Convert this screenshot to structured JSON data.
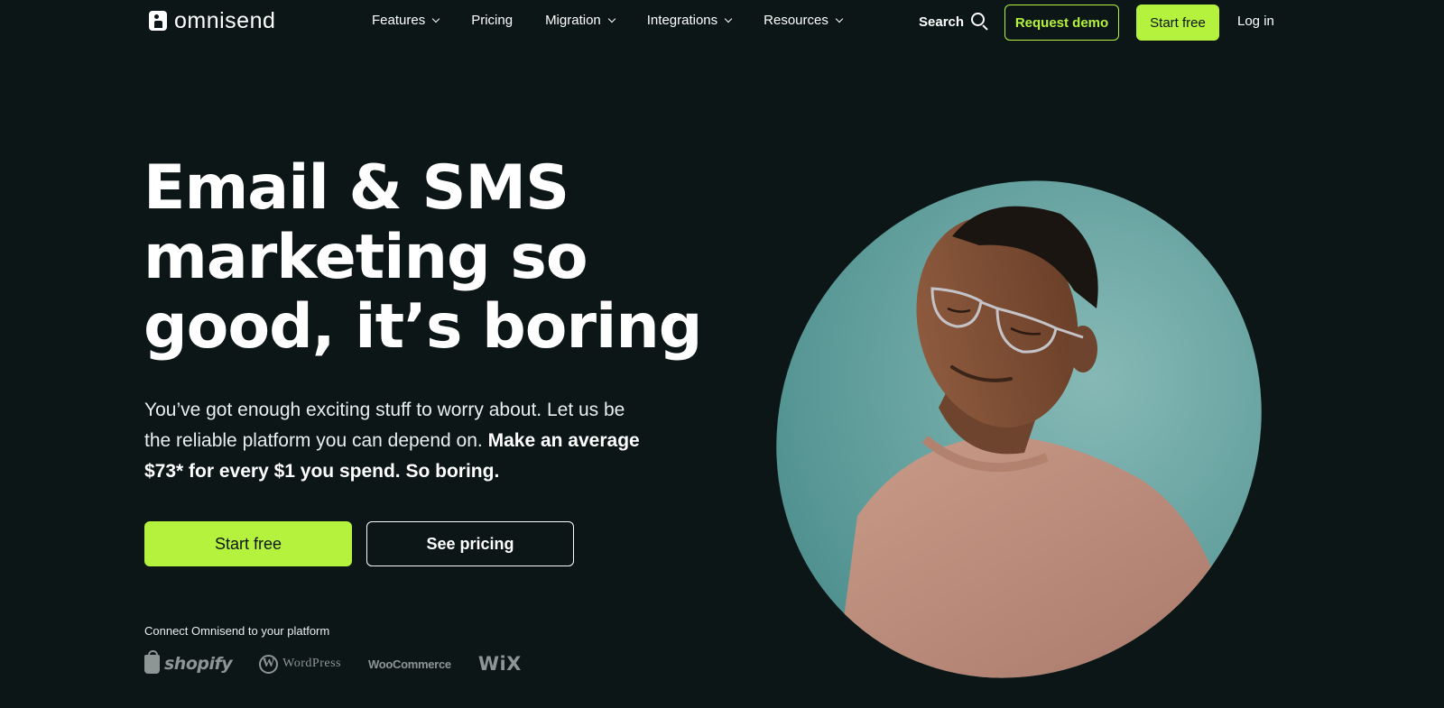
{
  "nav": {
    "logo_text": "omnisend",
    "menu": [
      {
        "label": "Features",
        "has_dropdown": true
      },
      {
        "label": "Pricing",
        "has_dropdown": false
      },
      {
        "label": "Migration",
        "has_dropdown": true
      },
      {
        "label": "Integrations",
        "has_dropdown": true
      },
      {
        "label": "Resources",
        "has_dropdown": true
      }
    ],
    "search_label": "Search",
    "request_demo": "Request demo",
    "start_free": "Start free",
    "log_in": "Log in"
  },
  "hero": {
    "headline_line1": "Email & SMS",
    "headline_line2": "marketing so",
    "headline_line3": "good, it’s boring",
    "subtext_regular": "You’ve got enough exciting stuff to worry about. Let us be the reliable platform you can depend on. ",
    "subtext_bold": "Make an average $73* for every $1 you spend. So boring.",
    "cta_primary": "Start free",
    "cta_secondary": "See pricing",
    "connect_label": "Connect Omnisend to your platform",
    "platforms": [
      "shopify",
      "WordPress",
      "WooCommerce",
      "WiX"
    ]
  },
  "colors": {
    "background": "#0c1616",
    "accent": "#b5f23d",
    "hero_circle": "#5fa3a1",
    "platform_logo": "#8e9595"
  },
  "icons": {
    "logo": "omnisend-logo-icon",
    "search": "search-icon",
    "dropdown": "chevron-down-icon"
  }
}
